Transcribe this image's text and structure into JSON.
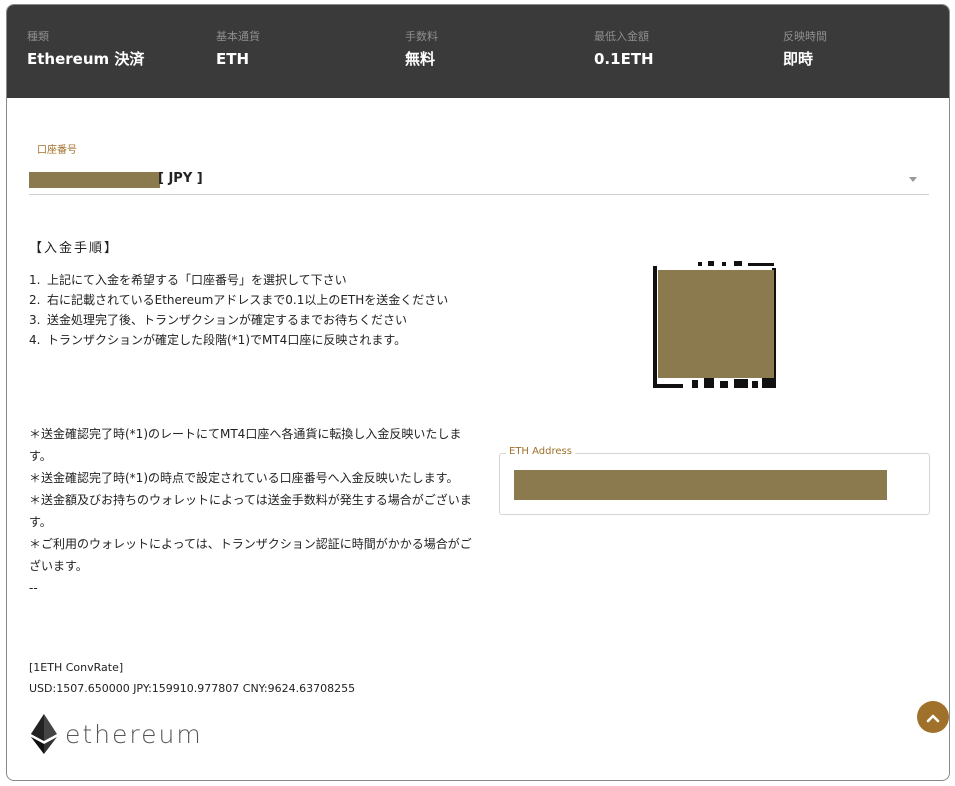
{
  "header": {
    "columns": [
      {
        "label": "種類",
        "value": "Ethereum 決済"
      },
      {
        "label": "基本通貨",
        "value": "ETH"
      },
      {
        "label": "手数料",
        "value": "無料"
      },
      {
        "label": "最低入金額",
        "value": "0.1ETH"
      },
      {
        "label": "反映時間",
        "value": "即時"
      }
    ]
  },
  "account": {
    "label": "口座番号",
    "currency": "[ JPY ]"
  },
  "procedure": {
    "title": "【入金手順】",
    "steps": [
      {
        "num": "1.",
        "text": "上記にて入金を希望する「口座番号」を選択して下さい"
      },
      {
        "num": "2.",
        "text": "右に記載されているEthereumアドレスまで0.1以上のETHを送金ください"
      },
      {
        "num": "3.",
        "text": "送金処理完了後、トランザクションが確定するまでお待ちください"
      },
      {
        "num": "4.",
        "text": "トランザクションが確定した段階(*1)でMT4口座に反映されます。"
      }
    ],
    "notes": [
      "＊送金確認完了時(*1)のレートにてMT4口座へ各通貨に転換し入金反映いたします。",
      "＊送金確認完了時(*1)の時点で設定されている口座番号へ入金反映いたします。",
      "＊送金額及びお持ちのウォレットによっては送金手数料が発生する場合がございます。",
      "＊ご利用のウォレットによっては、トランザクション認証に時間がかかる場合がございます。"
    ],
    "separator": "--"
  },
  "conv_rate": {
    "title": "[1ETH ConvRate]",
    "values": "USD:1507.650000 JPY:159910.977807 CNY:9624.63708255"
  },
  "eth_address": {
    "label": "ETH Address"
  },
  "logo": {
    "word": "ethereum"
  },
  "icons": {
    "logo": "ethereum-diamond-icon",
    "scroll": "chevron-up-icon",
    "dropdown": "caret-down-icon"
  },
  "colors": {
    "header_bg": "#3a3a3a",
    "accent": "#a0712b",
    "redaction": "#8b7a4d"
  }
}
